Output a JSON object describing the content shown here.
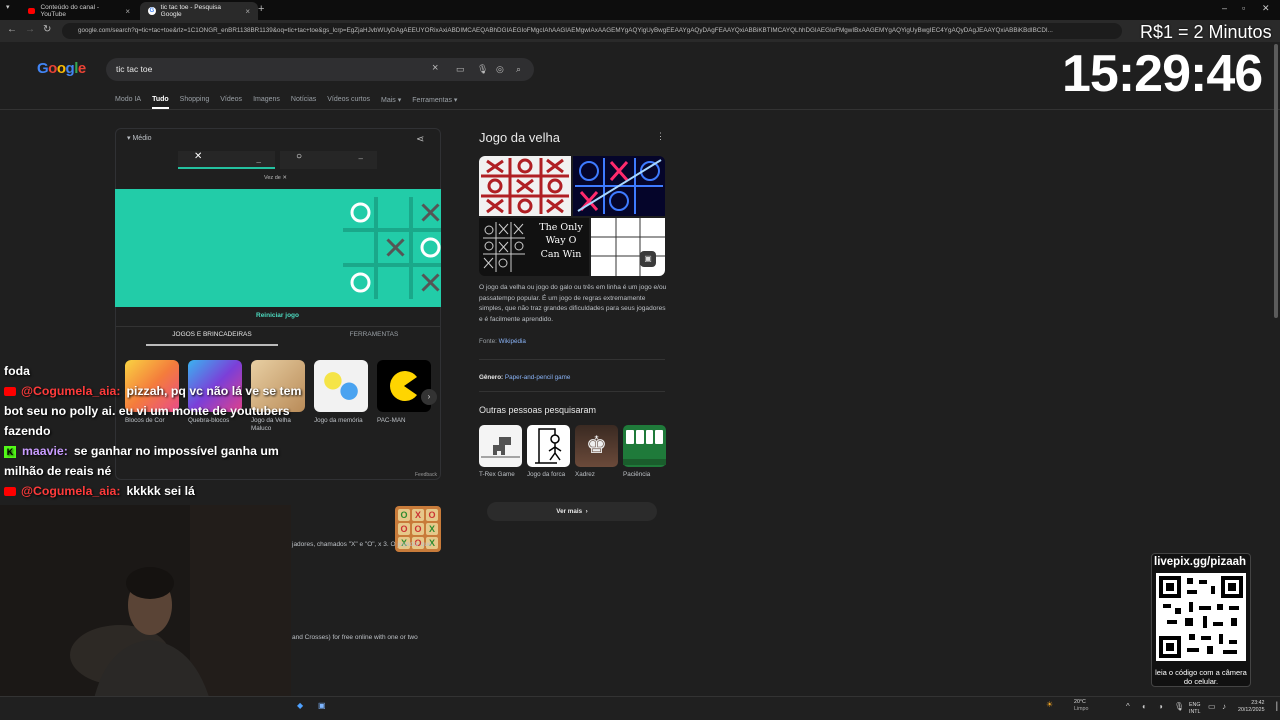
{
  "browser": {
    "tabs": [
      {
        "title": "Conteúdo do canal - YouTube",
        "icon": "youtube-icon"
      },
      {
        "title": "tic tac toe - Pesquisa Google",
        "icon": "google-icon"
      }
    ],
    "url": "google.com/search?q=tic+tac+toe&rlz=1C1ONGR_enBR1138BR1139&oq=tic+tac+toe&gs_lcrp=EgZjaHJvbWUyDAgAEEUYORixAxiABDIMCAEQABhDGIAEGIoFMgcIAhAAGIAEMgwIAxAAGEMYgAQYigUyBwgEEAAYgAQyDAgFEAAYQxiABBiKBTIMCAYQLhhDGIAEGIoFMgwIBxAAGEMYgAQYigUyBwgIEC4YgAQyDAgJEAAYQxiABBiKBdIBCDI..."
  },
  "google": {
    "logo": "Google",
    "query": "tic tac toe",
    "tabs": [
      "Modo IA",
      "Tudo",
      "Shopping",
      "Vídeos",
      "Imagens",
      "Notícias",
      "Vídeos curtos",
      "Mais ▾",
      "Ferramentas ▾"
    ]
  },
  "game": {
    "difficulty": "Médio",
    "player_x": {
      "mark": "✕",
      "score": "_"
    },
    "player_o": {
      "mark": "○",
      "score": "–"
    },
    "turn_label": "Vez de ✕",
    "board": [
      "O",
      "",
      "X",
      "",
      "X",
      "O",
      "O",
      "",
      "X"
    ],
    "restart": "Reiniciar jogo",
    "tabs": [
      "JOGOS E BRINCADEIRAS",
      "FERRAMENTAS"
    ],
    "games": [
      {
        "label": "Blocos de Cor",
        "color": "#f4a338"
      },
      {
        "label": "Quebra-blocos",
        "color": "#7b3fd8"
      },
      {
        "label": "Jogo da Velha Maluco",
        "color": "#d8b98a"
      },
      {
        "label": "Jogo da memória",
        "color": "#f2f2f2"
      },
      {
        "label": "PAC-MAN",
        "color": "#000000"
      }
    ],
    "feedback": "Feedback",
    "snippet1": "jadores, chamados \"X\" e \"O\", x 3. O jogador que",
    "snippet2": "and Crosses) for free online with one or two"
  },
  "knowledge": {
    "title": "Jogo da velha",
    "image_caption": "The Only Way O Can Win",
    "description": "O jogo da velha ou jogo do galo ou três em linha é um jogo e/ou passatempo popular. É um jogo de regras extremamente simples, que não traz grandes dificuldades para seus jogadores e é facilmente aprendido.",
    "source_label": "Fonte:",
    "source": "Wikipédia",
    "genre_label": "Gênero:",
    "genre": "Paper-and-pencil game",
    "also_title": "Outras pessoas pesquisaram",
    "also": [
      {
        "label": "T-Rex Game"
      },
      {
        "label": "Jogo da forca"
      },
      {
        "label": "Xadrez"
      },
      {
        "label": "Paciência"
      }
    ],
    "more": "Ver mais"
  },
  "overlay": {
    "clock": "15:29:46",
    "prize": "R$1 = 2 Minutos",
    "chat": [
      {
        "platform": "none",
        "user": "",
        "text": "foda"
      },
      {
        "platform": "youtube",
        "user": "@Cogumela_aia:",
        "text": "pizzah, pq vc não lá ve se tem bot seu no polly ai. eu vi um monte de youtubers fazendo"
      },
      {
        "platform": "kick",
        "user": "maavie:",
        "text": "se ganhar no impossível ganha um milhão de reais né"
      },
      {
        "platform": "youtube",
        "user": "@Cogumela_aia:",
        "text": "kkkkk sei lá"
      }
    ],
    "qr_title": "livepix.gg/pizaah",
    "qr_caption": "leia o código com a câmera do celular."
  },
  "taskbar": {
    "weather_temp": "20°C",
    "weather_desc": "Limpo",
    "lang1": "ENG",
    "lang2": "INTL",
    "time": "23:42",
    "date": "20/12/2025"
  },
  "colors": {
    "board": "#22cca8",
    "accent": "#24c1a0",
    "link": "#8ab4f8",
    "youtube": "#ff0000",
    "kick": "#53fc18"
  }
}
